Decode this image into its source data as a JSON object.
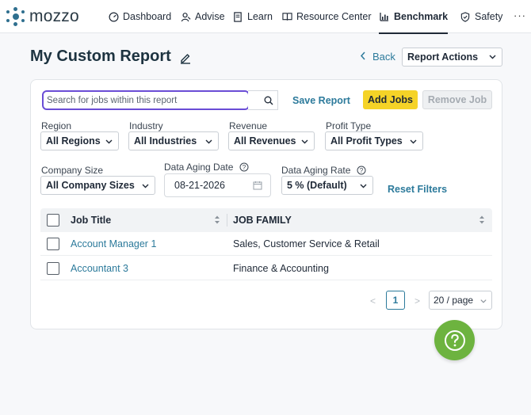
{
  "brand": {
    "name": "mozzo",
    "accent": "#2c7a9b",
    "logo_color": "#2f6f8f"
  },
  "nav": {
    "items": [
      {
        "label": "Dashboard",
        "icon": "dashboard-gauge-icon"
      },
      {
        "label": "Advise",
        "icon": "advise-person-icon"
      },
      {
        "label": "Learn",
        "icon": "learn-book-icon"
      },
      {
        "label": "Resource Center",
        "icon": "resource-center-book-icon"
      },
      {
        "label": "Benchmark",
        "icon": "benchmark-chart-icon",
        "active": true
      },
      {
        "label": "Safety",
        "icon": "safety-shield-icon"
      }
    ],
    "more": "···"
  },
  "header": {
    "title": "My Custom Report",
    "back_label": "Back",
    "report_actions_label": "Report Actions"
  },
  "toolbar": {
    "search_placeholder": "Search for jobs within this report",
    "save_report_label": "Save Report",
    "add_jobs_label": "Add Jobs",
    "remove_job_label": "Remove Job"
  },
  "filters": {
    "region": {
      "label": "Region",
      "value": "All Regions"
    },
    "industry": {
      "label": "Industry",
      "value": "All Industries"
    },
    "revenue": {
      "label": "Revenue",
      "value": "All Revenues"
    },
    "profit_type": {
      "label": "Profit Type",
      "value": "All Profit Types"
    },
    "company_size": {
      "label": "Company Size",
      "value": "All Company Sizes"
    },
    "data_aging_date": {
      "label": "Data Aging Date",
      "value": "08-21-2026"
    },
    "data_aging_rate": {
      "label": "Data Aging Rate",
      "value": "5 % (Default)"
    },
    "reset_label": "Reset Filters"
  },
  "table": {
    "columns": [
      "Job Title",
      "JOB FAMILY"
    ],
    "rows": [
      {
        "job_title": "Account Manager 1",
        "job_family": "Sales, Customer Service & Retail"
      },
      {
        "job_title": "Accountant 3",
        "job_family": "Finance & Accounting"
      }
    ]
  },
  "pagination": {
    "prev": "<",
    "current_page": "1",
    "next": ">",
    "page_size": "20 / page"
  },
  "help": {
    "icon": "help-question-icon",
    "color": "#6db33f"
  }
}
